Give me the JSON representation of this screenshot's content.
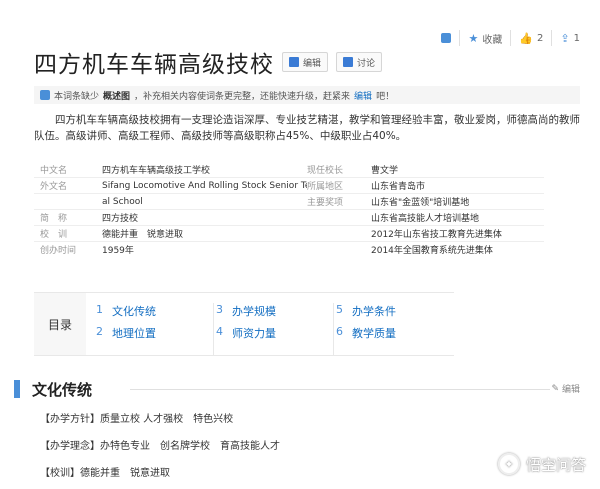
{
  "topbar": {
    "favorite_label": "收藏",
    "like_count": "2",
    "share_count": "1"
  },
  "title": "四方机车车辆高级技校",
  "buttons": {
    "edit": "编辑",
    "discuss": "讨论"
  },
  "notice": {
    "prefix": "本词条缺少",
    "missing": "概述图",
    "middle": "，补充相关内容使词条更完整，还能快速升级，赶紧来",
    "link": "编辑",
    "suffix": "吧！"
  },
  "summary": "四方机车车辆高级技校拥有一支理论造诣深厚、专业技艺精湛，教学和管理经验丰富，敬业爱岗，师德高尚的教师队伍。高级讲师、高级工程师、高级技师等高级职称占45%、中级职业占40%。",
  "info": [
    {
      "k1": "中文名",
      "v1": "四方机车车辆高级技工学校",
      "k2": "现任校长",
      "v2": "曹文学"
    },
    {
      "k1": "外文名",
      "v1": "Sifang Locomotive And Rolling Stock Senior Technic",
      "k2": "所属地区",
      "v2": "山东省青岛市"
    },
    {
      "k1": "",
      "v1": "al School",
      "k2": "主要奖项",
      "v2": "山东省\"金蓝领\"培训基地"
    },
    {
      "k1": "简　称",
      "v1": "四方技校",
      "k2": "",
      "v2": "山东省高技能人才培训基地"
    },
    {
      "k1": "校　训",
      "v1": "德能并重　锐意进取",
      "k2": "",
      "v2": "2012年山东省技工教育先进集体"
    },
    {
      "k1": "创办时间",
      "v1": "1959年",
      "k2": "",
      "v2": "2014年全国教育系统先进集体"
    }
  ],
  "toc": {
    "label": "目录",
    "columns": [
      [
        {
          "num": "1",
          "text": "文化传统"
        },
        {
          "num": "2",
          "text": "地理位置"
        }
      ],
      [
        {
          "num": "3",
          "text": "办学规模"
        },
        {
          "num": "4",
          "text": "师资力量"
        }
      ],
      [
        {
          "num": "5",
          "text": "办学条件"
        },
        {
          "num": "6",
          "text": "教学质量"
        }
      ]
    ]
  },
  "section": {
    "title": "文化传统",
    "edit": "编辑"
  },
  "paragraphs": [
    "【办学方针】质量立校 人才强校　特色兴校",
    "【办学理念】办特色专业　创名牌学校　育高技能人才",
    "【校训】德能并重　锐意进取"
  ],
  "watermark": "悟空问答"
}
